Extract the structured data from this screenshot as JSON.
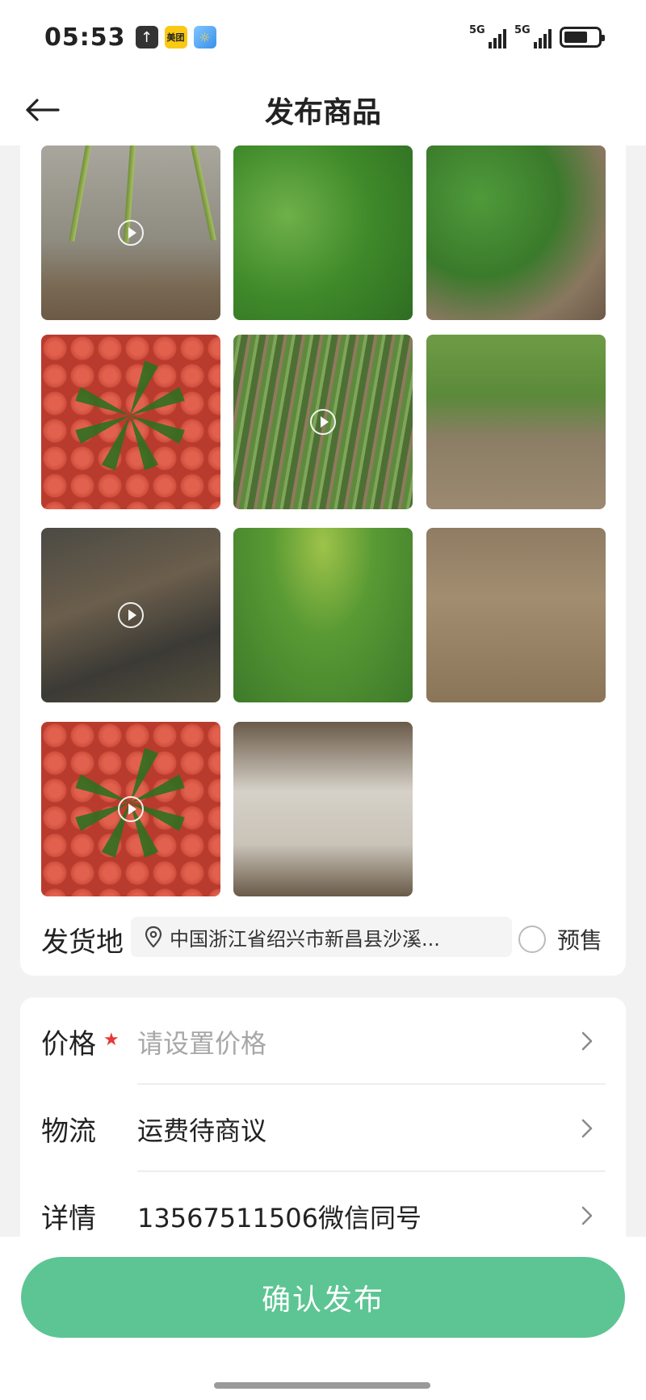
{
  "status_bar": {
    "time": "05:53",
    "signal1_label": "5G",
    "signal2_label": "5G",
    "app_icons": [
      "upload-icon",
      "meituan-icon",
      "weather-icon"
    ],
    "meituan_text": "美团"
  },
  "header": {
    "title": "发布商品",
    "back_icon": "arrow-left-icon"
  },
  "media": {
    "items": [
      {
        "type": "video"
      },
      {
        "type": "image"
      },
      {
        "type": "image"
      },
      {
        "type": "image"
      },
      {
        "type": "video"
      },
      {
        "type": "image"
      },
      {
        "type": "video"
      },
      {
        "type": "image"
      },
      {
        "type": "image"
      },
      {
        "type": "video"
      },
      {
        "type": "image"
      }
    ]
  },
  "shipping": {
    "label": "发货地",
    "location": "中国浙江省绍兴市新昌县沙溪...",
    "presale_label": "预售",
    "presale_checked": false
  },
  "form": {
    "price_label": "价格",
    "price_placeholder": "请设置价格",
    "logistics_label": "物流",
    "logistics_value": "运费待商议",
    "details_label": "详情",
    "details_value": "13567511506微信同号"
  },
  "actions": {
    "confirm_label": "确认发布"
  },
  "colors": {
    "primary": "#5cc593",
    "required": "#e53935"
  }
}
